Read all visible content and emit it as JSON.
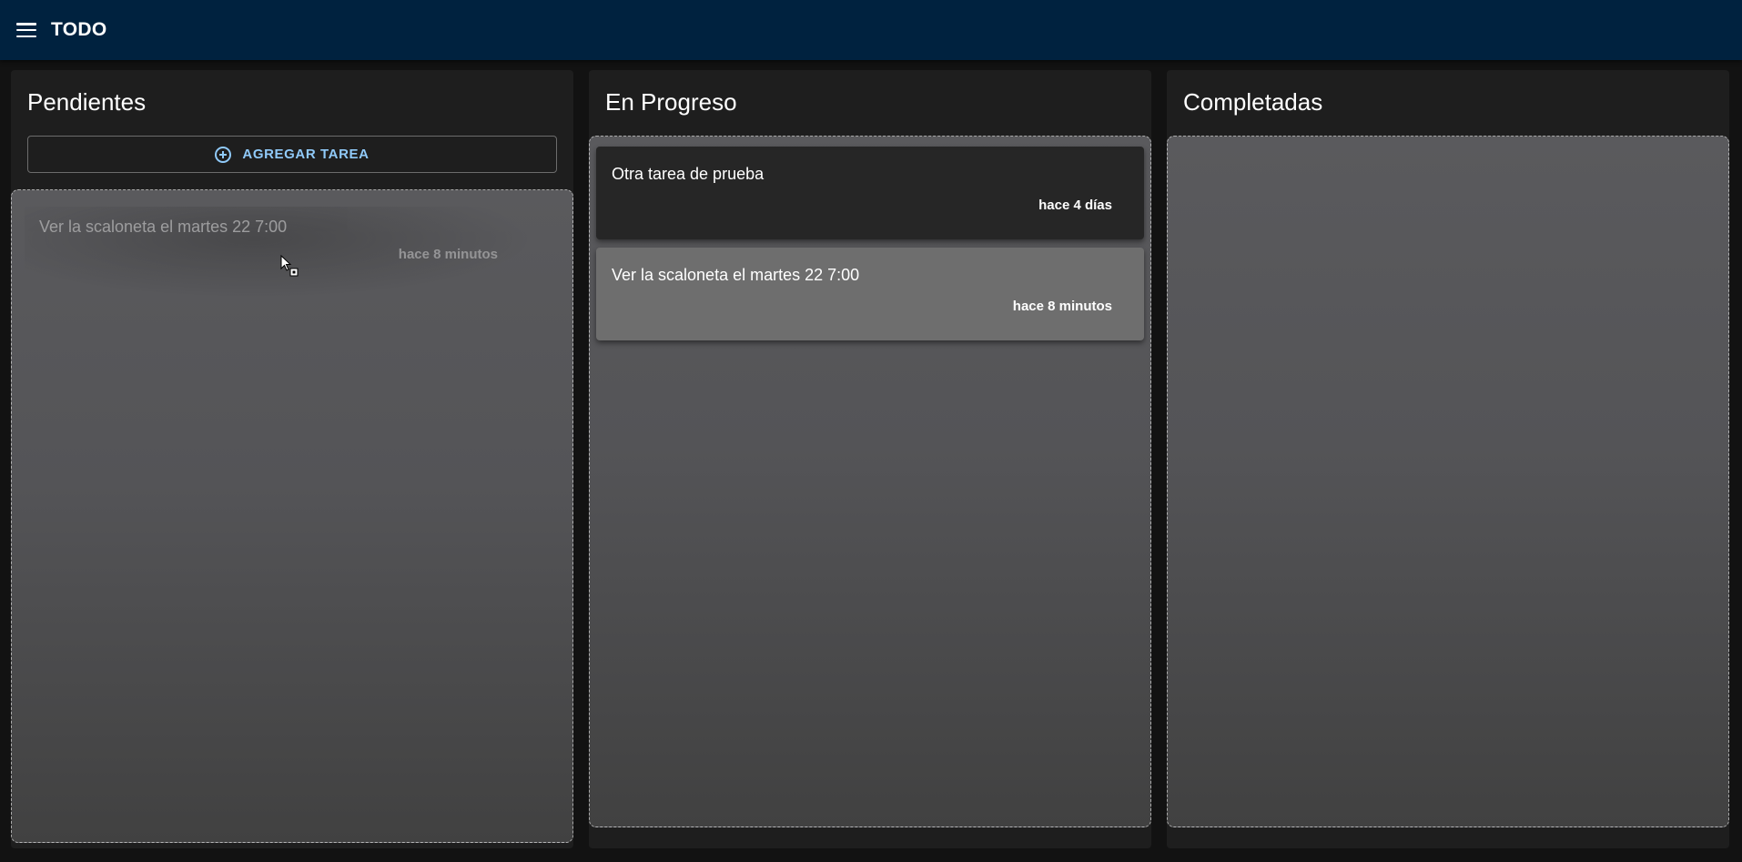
{
  "app": {
    "title": "TODO"
  },
  "columns": [
    {
      "title": "Pendientes",
      "add_button": "AGREGAR TAREA",
      "dragging_card": {
        "text": "Ver la scaloneta el martes 22 7:00",
        "time": "hace 8 minutos"
      }
    },
    {
      "title": "En Progreso",
      "cards": [
        {
          "text": "Otra tarea de prueba",
          "time": "hace 4 días"
        },
        {
          "text": "Ver la scaloneta el martes 22 7:00",
          "time": "hace 8 minutos"
        }
      ]
    },
    {
      "title": "Completadas",
      "cards": []
    }
  ],
  "colors": {
    "appbar": "#00223f",
    "accent": "#90caf9",
    "column_bg": "#1e1e1e"
  }
}
